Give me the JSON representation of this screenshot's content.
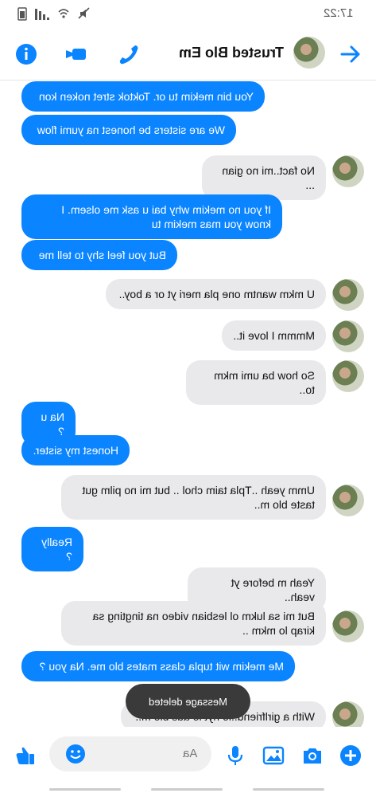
{
  "status": {
    "time": "17:22"
  },
  "header": {
    "contact_name": "Trusted Blo Em"
  },
  "messages": [
    {
      "side": "out",
      "text": "You bin mekim tu or. Toktok stret noken kon"
    },
    {
      "side": "out",
      "text": "We are sisters be honest na yumi flow"
    },
    {
      "side": "in",
      "text": "No fact..mi no gian ..."
    },
    {
      "side": "out",
      "text": "If you no mekim why bai u ask me olsem. I know you mas mekim tu"
    },
    {
      "side": "out",
      "text": "But you feel shy to tell me"
    },
    {
      "side": "in",
      "text": "U mkm wantm one pla meri yt or a boy.."
    },
    {
      "side": "in",
      "text": "Mmmm I love it.."
    },
    {
      "side": "in",
      "text": "So how ba umi mkm to.."
    },
    {
      "side": "out",
      "text": "Na u ?"
    },
    {
      "side": "out",
      "text": "Honest my sister."
    },
    {
      "side": "in",
      "text": "Umm yeah ..Tpla taim chol .. but mi no pilm gut taste blo m.."
    },
    {
      "side": "out",
      "text": "Really ?"
    },
    {
      "side": "in",
      "text": "Yeah m before yt yeah.."
    },
    {
      "side": "in",
      "text": "But mi sa lukm ol lesbian video na tingting sa kirap lo mkm .."
    },
    {
      "side": "out",
      "text": "Me mekim wit tupla class mates blo me. Na you ?"
    },
    {
      "side": "in",
      "text": "With a girlfriend..lo nyt lo aus blo m.."
    }
  ],
  "toast": "Message deleted",
  "composer": {
    "placeholder": "Aa"
  },
  "colors": {
    "accent": "#0a84ff",
    "incoming": "#e9e9eb",
    "toast": "#3a3a3a"
  }
}
